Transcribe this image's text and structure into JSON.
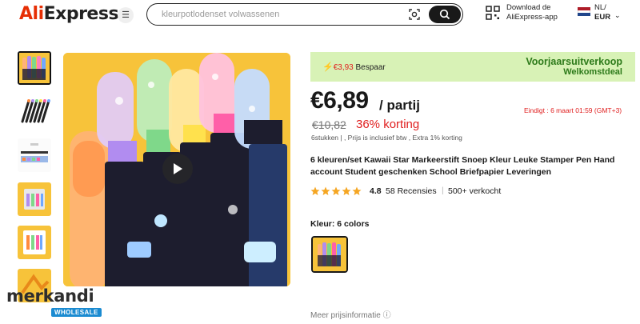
{
  "header": {
    "logo": "AliExpress",
    "logo_prefix": "Ali",
    "logo_suffix": "Express",
    "search_placeholder": "kleurpotlodenset volwassenen",
    "download_line1": "Download de",
    "download_line2": "AliExpress-app",
    "lang": "NL/",
    "currency": "EUR",
    "icons": [
      "menu-icon",
      "camera-icon",
      "search-icon",
      "qr-code-icon",
      "netherlands-flag-icon",
      "chevron-down-icon"
    ]
  },
  "gallery": {
    "thumbnail_count": 6,
    "selected_index": 0,
    "play_icon": "play-icon"
  },
  "watermark": {
    "brand": "merkandi",
    "tag": "WHOLESALE"
  },
  "promo": {
    "save_amount": "€3,93",
    "save_label": "Bespaar",
    "title": "Voorjaarsuitverkoop",
    "subtitle": "Welkomstdeal",
    "bolt_icon": "lightning-icon"
  },
  "pricing": {
    "price": "€6,89",
    "unit": "/ partij",
    "deadline": "Eindigt :  6 maart 01:59 (GMT+3)",
    "original_price": "€10,82",
    "discount": "36% korting",
    "tax_info": "6stukken | , Prijs is inclusief btw , Extra 1% korting"
  },
  "product": {
    "title": "6 kleuren/set Kawaii Star Markeerstift Snoep Kleur Leuke Stamper Pen Hand account Student geschenken School Briefpapier Leveringen",
    "rating": "4.8",
    "stars": 5,
    "reviews": "58 Recensies",
    "separator": "|",
    "sold": "500+ verkocht",
    "color_label": "Kleur: 6 colors",
    "more_info": "Meer prijsinformatie ⓘ"
  },
  "colors": {
    "accent_red": "#e02020",
    "promo_bg": "#d8f2b6",
    "promo_text": "#2d7a1a",
    "star": "#f5a623",
    "image_bg": "#f7c33a"
  }
}
